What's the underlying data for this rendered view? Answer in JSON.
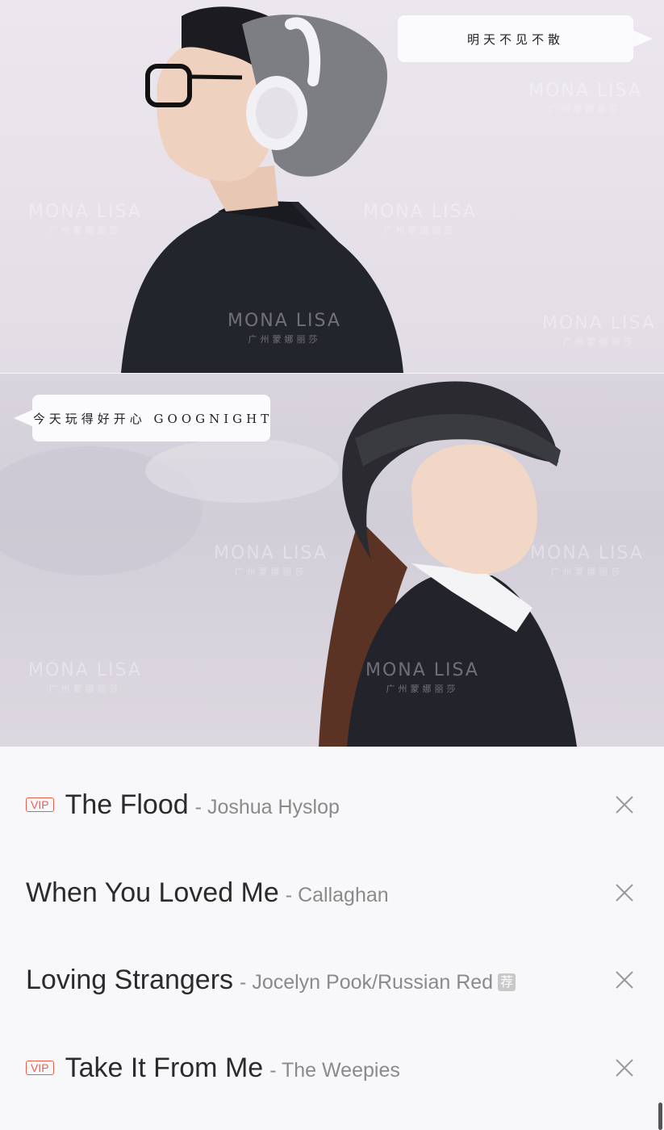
{
  "photos": {
    "top": {
      "bubble_text": "明天不见不散",
      "watermarks": [
        "MONA LISA",
        "MONA LISA",
        "MONA LISA",
        "MONA LISA",
        "MONA LISA"
      ],
      "watermark_sub": "广州蒙娜丽莎"
    },
    "bottom": {
      "bubble_text": "今天玩得好开心  GOOGNIGHT",
      "watermarks": [
        "MONA LISA",
        "MONA LISA",
        "MONA LISA",
        "MONA LISA"
      ],
      "watermark_sub": "广州蒙娜丽莎"
    }
  },
  "playlist": {
    "vip_label": "VIP",
    "rec_label": "荐",
    "songs": [
      {
        "title": "The Flood",
        "artist": "- Joshua Hyslop",
        "vip": true,
        "recommended": false
      },
      {
        "title": "When You Loved Me",
        "artist": "- Callaghan",
        "vip": false,
        "recommended": false
      },
      {
        "title": "Loving Strangers",
        "artist": "- Jocelyn Pook/Russian Red",
        "vip": false,
        "recommended": true
      },
      {
        "title": "Take It From Me",
        "artist": "- The Weepies",
        "vip": true,
        "recommended": false
      }
    ]
  },
  "icons": {
    "remove": "close-icon"
  },
  "colors": {
    "vip": "#ef5b4b",
    "title": "#2b2b2b",
    "artist": "#8a8a8a"
  }
}
